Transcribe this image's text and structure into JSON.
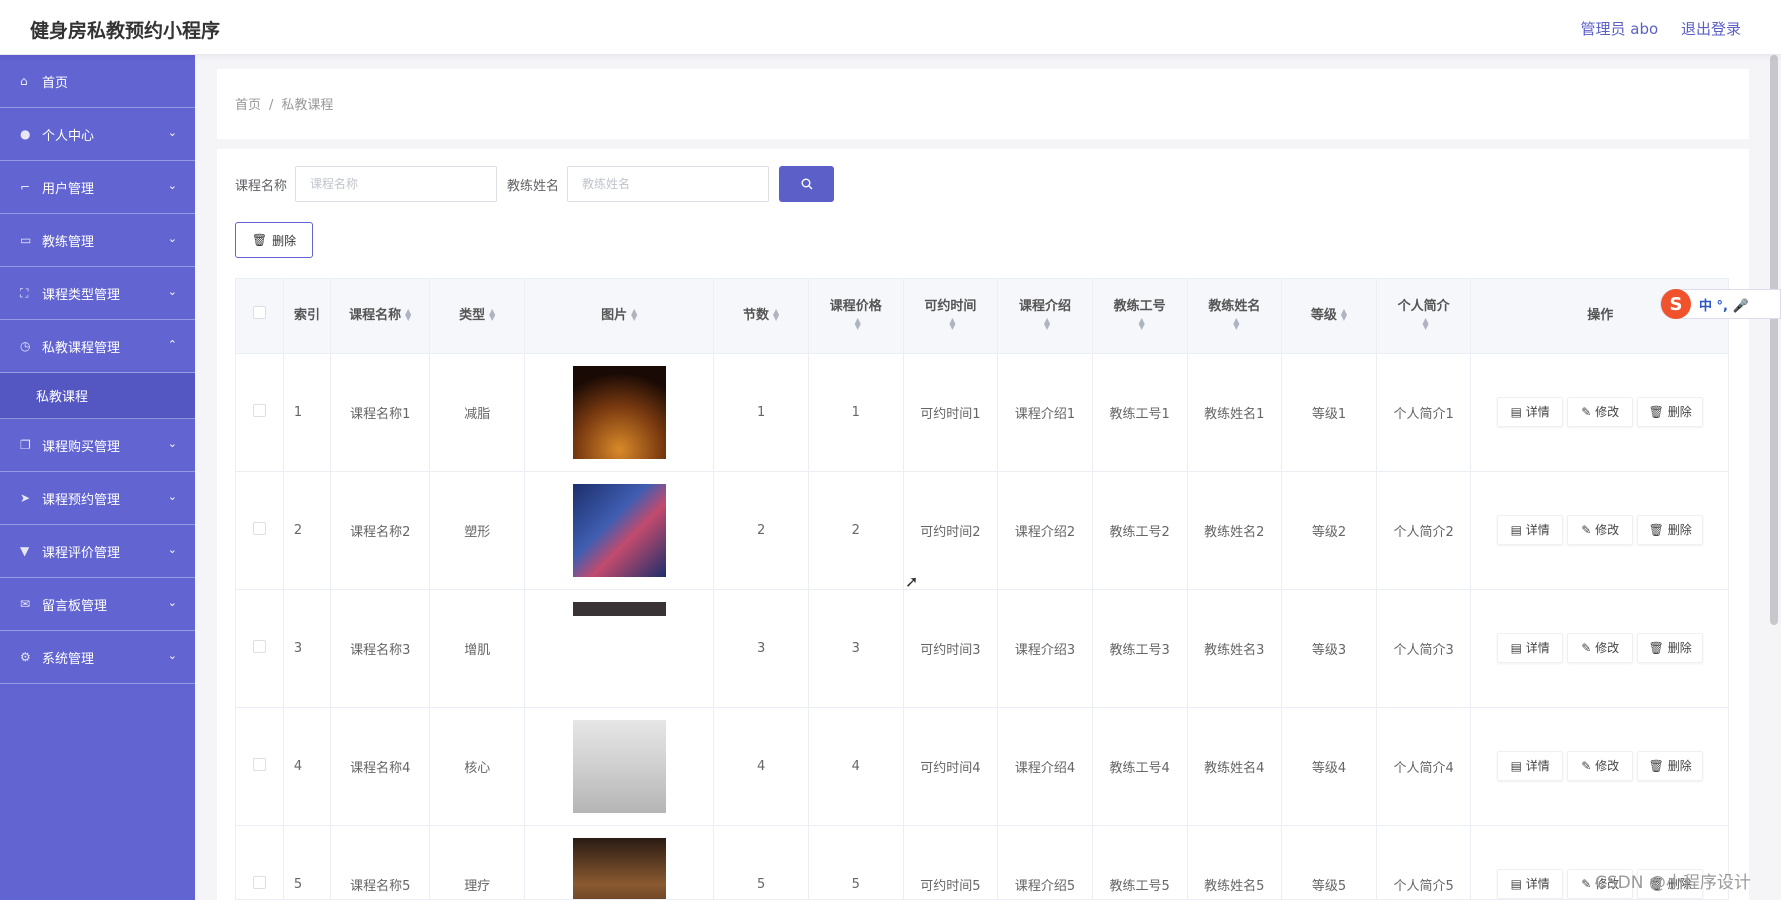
{
  "header": {
    "title": "健身房私教预约小程序",
    "admin": "管理员 abo",
    "logout": "退出登录"
  },
  "sidebar": {
    "items": [
      {
        "label": "首页",
        "icon": "home-icon",
        "chevron": ""
      },
      {
        "label": "个人中心",
        "icon": "user-icon",
        "chevron": "⌄"
      },
      {
        "label": "用户管理",
        "icon": "crop-icon",
        "chevron": "⌄"
      },
      {
        "label": "教练管理",
        "icon": "chat-icon",
        "chevron": "⌄"
      },
      {
        "label": "课程类型管理",
        "icon": "frame-icon",
        "chevron": "⌄"
      },
      {
        "label": "私教课程管理",
        "icon": "clock-icon",
        "chevron": "⌃"
      },
      {
        "label": "课程购买管理",
        "icon": "copy-icon",
        "chevron": "⌄"
      },
      {
        "label": "课程预约管理",
        "icon": "send-icon",
        "chevron": "⌄"
      },
      {
        "label": "课程评价管理",
        "icon": "stamp-icon",
        "chevron": "⌄"
      },
      {
        "label": "留言板管理",
        "icon": "mail-icon",
        "chevron": "⌄"
      },
      {
        "label": "系统管理",
        "icon": "settings-icon",
        "chevron": "⌄"
      }
    ],
    "submenu_active": "私教课程"
  },
  "breadcrumb": {
    "home": "首页",
    "sep": "/",
    "current": "私教课程"
  },
  "search": {
    "course_label": "课程名称",
    "course_placeholder": "课程名称",
    "coach_label": "教练姓名",
    "coach_placeholder": "教练姓名",
    "search_icon": "search-icon"
  },
  "actions": {
    "delete_label": "删除"
  },
  "table": {
    "headers": {
      "index": "索引",
      "name": "课程名称",
      "type": "类型",
      "image": "图片",
      "sessions": "节数",
      "price": "课程价格",
      "time": "可约时间",
      "intro": "课程介绍",
      "coach_no": "教练工号",
      "coach_name": "教练姓名",
      "level": "等级",
      "bio": "个人简介",
      "ops": "操作"
    },
    "ops": {
      "detail": "详情",
      "edit": "修改",
      "delete": "删除"
    },
    "rows": [
      {
        "index": "1",
        "name": "课程名称1",
        "type": "减脂",
        "sessions": "1",
        "price": "1",
        "time": "可约时间1",
        "intro": "课程介绍1",
        "coach_no": "教练工号1",
        "coach_name": "教练姓名1",
        "level": "等级1",
        "bio": "个人简介1",
        "img": "photo-dance"
      },
      {
        "index": "2",
        "name": "课程名称2",
        "type": "塑形",
        "sessions": "2",
        "price": "2",
        "time": "可约时间2",
        "intro": "课程介绍2",
        "coach_no": "教练工号2",
        "coach_name": "教练姓名2",
        "level": "等级2",
        "bio": "个人简介2",
        "img": "photo-gym"
      },
      {
        "index": "3",
        "name": "课程名称3",
        "type": "增肌",
        "sessions": "3",
        "price": "3",
        "time": "可约时间3",
        "intro": "课程介绍3",
        "coach_no": "教练工号3",
        "coach_name": "教练姓名3",
        "level": "等级3",
        "bio": "个人简介3",
        "img": "photo-loading"
      },
      {
        "index": "4",
        "name": "课程名称4",
        "type": "核心",
        "sessions": "4",
        "price": "4",
        "time": "可约时间4",
        "intro": "课程介绍4",
        "coach_no": "教练工号4",
        "coach_name": "教练姓名4",
        "level": "等级4",
        "bio": "个人简介4",
        "img": "photo-aerial"
      },
      {
        "index": "5",
        "name": "课程名称5",
        "type": "理疗",
        "sessions": "5",
        "price": "5",
        "time": "可约时间5",
        "intro": "课程介绍5",
        "coach_no": "教练工号5",
        "coach_name": "教练姓名5",
        "level": "等级5",
        "bio": "个人简介5",
        "img": "photo-poster"
      }
    ]
  },
  "ime": {
    "logo": "S",
    "text": "中 °, 🎤"
  },
  "watermark": "CSDN @小程序设计"
}
